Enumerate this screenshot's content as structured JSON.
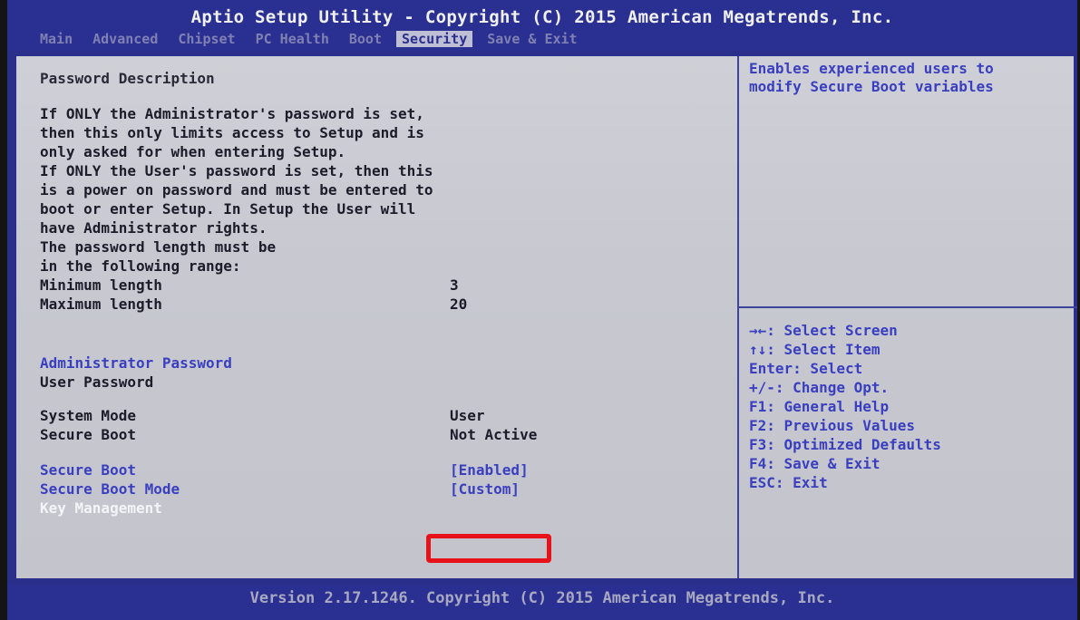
{
  "header": {
    "title": "Aptio Setup Utility - Copyright (C) 2015 American Megatrends, Inc.",
    "tabs": [
      {
        "label": "Main",
        "active": false
      },
      {
        "label": "Advanced",
        "active": false
      },
      {
        "label": "Chipset",
        "active": false
      },
      {
        "label": "PC Health",
        "active": false
      },
      {
        "label": "Boot",
        "active": false
      },
      {
        "label": "Security",
        "active": true
      },
      {
        "label": "Save & Exit",
        "active": false
      }
    ]
  },
  "description": {
    "title": "Password Description",
    "lines": [
      "If ONLY the Administrator's password is set,",
      "then this only limits access to Setup and is",
      "only asked for when entering Setup.",
      "If ONLY the User's password is set, then this",
      "is a power on password and must be entered to",
      "boot or enter Setup. In Setup the User will",
      "have Administrator rights.",
      "The password length must be",
      "in the following range:"
    ],
    "min_label": "Minimum length",
    "min_value": "3",
    "max_label": "Maximum length",
    "max_value": "20"
  },
  "passwords": {
    "admin_label": "Administrator Password",
    "user_label": "User Password"
  },
  "status": {
    "system_mode_label": "System Mode",
    "system_mode_value": "User",
    "secure_boot_label": "Secure Boot",
    "secure_boot_value": "Not Active"
  },
  "options": {
    "secure_boot_label": "Secure Boot",
    "secure_boot_value": "[Enabled]",
    "secure_boot_mode_label": "Secure Boot Mode",
    "secure_boot_mode_value": "[Custom]",
    "key_management_label": "Key Management"
  },
  "help": {
    "text_line1": "Enables experienced users to",
    "text_line2": "modify Secure Boot variables"
  },
  "keys": [
    "→←: Select Screen",
    "↑↓: Select Item",
    "Enter: Select",
    "+/-: Change Opt.",
    "F1: General Help",
    "F2: Previous Values",
    "F3: Optimized Defaults",
    "F4: Save & Exit",
    "ESC: Exit"
  ],
  "footer": {
    "version": "Version 2.17.1246. Copyright (C) 2015 American Megatrends, Inc."
  },
  "colors": {
    "frame_blue": "#2a2f8c",
    "panel_grey": "#c9cad2",
    "option_blue": "#3a3fc0",
    "highlight_red": "#e8121a"
  }
}
